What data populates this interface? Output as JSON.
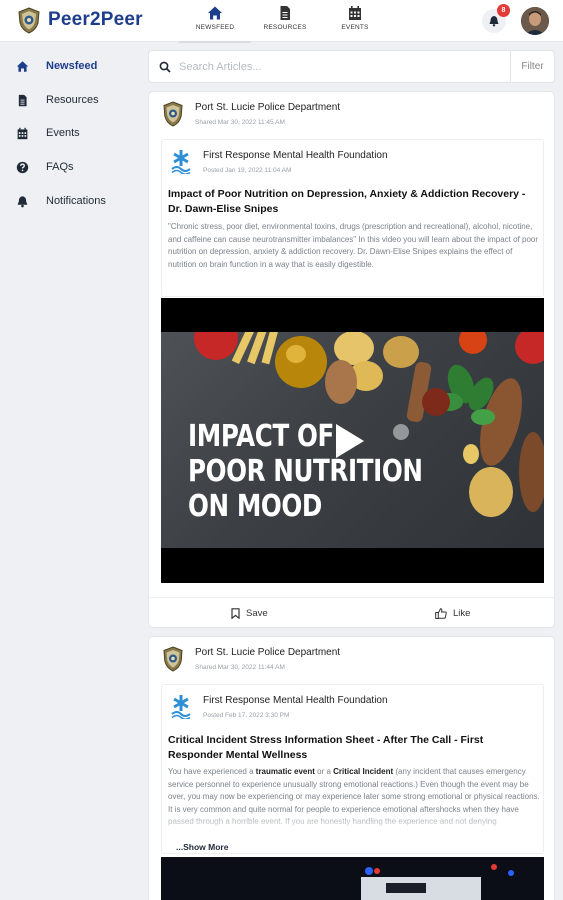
{
  "app": {
    "title": "Peer2Peer"
  },
  "topnav": [
    {
      "label": "NEWSFEED",
      "icon": "home-icon",
      "active": true
    },
    {
      "label": "RESOURCES",
      "icon": "document-icon",
      "active": false
    },
    {
      "label": "EVENTS",
      "icon": "calendar-icon",
      "active": false
    }
  ],
  "notifications": {
    "count": "8"
  },
  "sidebar": {
    "items": [
      {
        "label": "Newsfeed",
        "icon": "home-icon",
        "active": true
      },
      {
        "label": "Resources",
        "icon": "document-icon",
        "active": false
      },
      {
        "label": "Events",
        "icon": "calendar-icon",
        "active": false
      },
      {
        "label": "FAQs",
        "icon": "question-circle-icon",
        "active": false
      },
      {
        "label": "Notifications",
        "icon": "bell-icon",
        "active": false
      }
    ]
  },
  "search": {
    "placeholder": "Search Articles...",
    "filter_label": "Filter"
  },
  "posts": [
    {
      "author": "Port St. Lucie Police Department",
      "shared": "Shared Mar 30, 2022 11:45 AM",
      "org": "First Response Mental Health Foundation",
      "posted": "Posted Jan 19, 2022 11:04 AM",
      "title": "Impact of Poor Nutrition on Depression, Anxiety & Addiction Recovery - Dr. Dawn-Elise Snipes",
      "body": "\"Chronic stress, poor diet, environmental toxins, drugs (prescription and recreational), alcohol, nicotine, and caffeine can cause neurotransmitter imbalances\" In this video you will learn about the impact of poor nutrition on depression, anxiety & addiction recovery. Dr. Dawn-Elise Snipes explains the effect of nutrition on brain function in a way that is easily digestible.",
      "video_text": "IMPACT OF\nPOOR NUTRITION\nON MOOD",
      "save_label": "Save",
      "like_label": "Like"
    },
    {
      "author": "Port St. Lucie Police Department",
      "shared": "Shared Mar 30, 2022 11:44 AM",
      "org": "First Response Mental Health Foundation",
      "posted": "Posted Feb 17, 2022 3:30 PM",
      "title": "Critical Incident Stress Information Sheet - After The Call - First Responder Mental Wellness",
      "body_parts": {
        "p1": "You have experienced a ",
        "b1": "traumatic event",
        "p2": " or a ",
        "b2": "Critical Incident",
        "p3": " (any incident that causes emergency service  personnel to experience unusually strong emotional reactions.) Even though the event may be over, you may  now be experiencing or may experience later some strong emotional or physical reactions. It is very common and quite normal for people to experience emotional aftershocks when they have passed through a horrible event. If you are honestly handling the experience and not denying"
      },
      "show_more_label": "...Show More"
    }
  ]
}
